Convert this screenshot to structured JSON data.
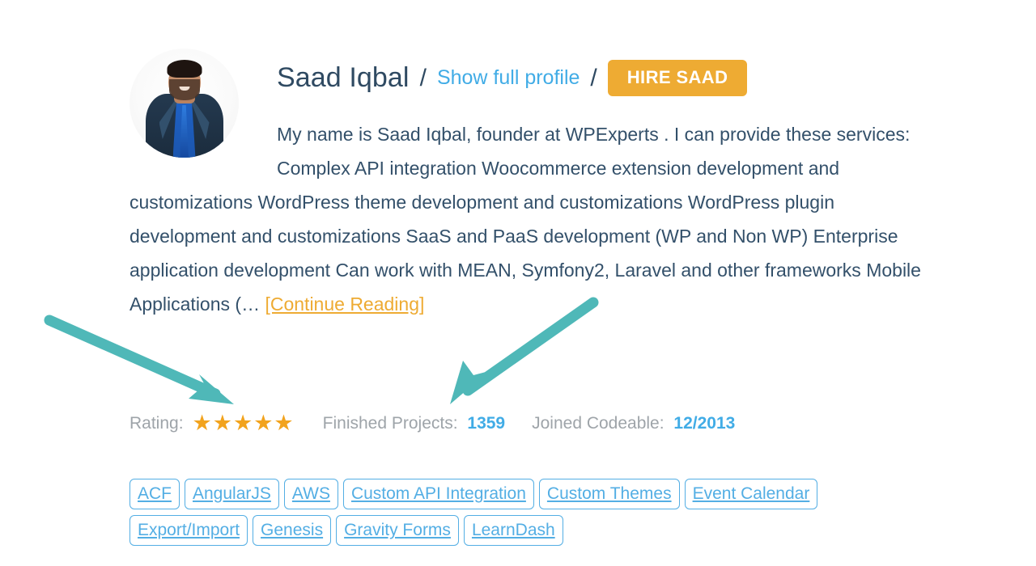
{
  "profile": {
    "name": "Saad Iqbal",
    "separator": "/",
    "show_profile_label": "Show full profile",
    "hire_button_label": "HIRE SAAD",
    "avatar_alt": "Saad Iqbal profile photo",
    "bio_part_1": "My name is Saad Iqbal, founder at WPExperts . I can provide these services: Complex API integration Woocommerce extension development and customizations WordPress theme development and customizations WordPress plugin development and customizations SaaS and PaaS development (WP and Non WP) Enterprise application development Can work with MEAN, Symfony2, Laravel and other frameworks Mobile Applications (… ",
    "continue_reading_label": "[Continue Reading]"
  },
  "stats": {
    "rating_label": "Rating:",
    "rating_stars": "★★★★★",
    "rating_value": 5,
    "finished_projects_label": "Finished Projects:",
    "finished_projects_value": "1359",
    "joined_label": "Joined Codeable:",
    "joined_value": "12/2013"
  },
  "tags": [
    "ACF",
    "AngularJS",
    "AWS",
    "Custom API Integration",
    "Custom Themes",
    "Event Calendar",
    "Export/Import",
    "Genesis",
    "Gravity Forms",
    "LearnDash"
  ],
  "colors": {
    "accent_orange": "#eeab33",
    "link_blue": "#41ace6",
    "tag_blue": "#53aee4",
    "text_dark": "#33506a",
    "muted_gray": "#9ea4a9",
    "star_amber": "#f2a31d",
    "annotation_teal": "#4fb8b8"
  },
  "annotations": {
    "arrow_1_name": "arrow-pointing-to-rating-stars",
    "arrow_2_name": "arrow-pointing-to-finished-projects"
  }
}
